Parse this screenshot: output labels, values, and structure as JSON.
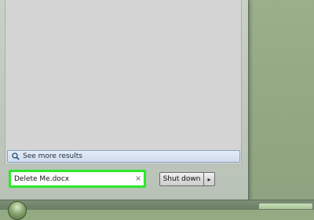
{
  "start_menu": {
    "see_more_results": "See more results",
    "search": {
      "value": "Delete Me.docx",
      "clear_glyph": "×"
    },
    "shutdown": {
      "label": "Shut down",
      "arrow_glyph": "▸"
    }
  },
  "icons": {
    "see_more": "magnifier-icon",
    "clear": "clear-icon",
    "shutdown_arrow": "chevron-right-icon",
    "start": "windows-start-icon"
  },
  "colors": {
    "highlight": "#2de82b",
    "desktop": "#93aa83",
    "results_bg": "#d4d4d4"
  }
}
